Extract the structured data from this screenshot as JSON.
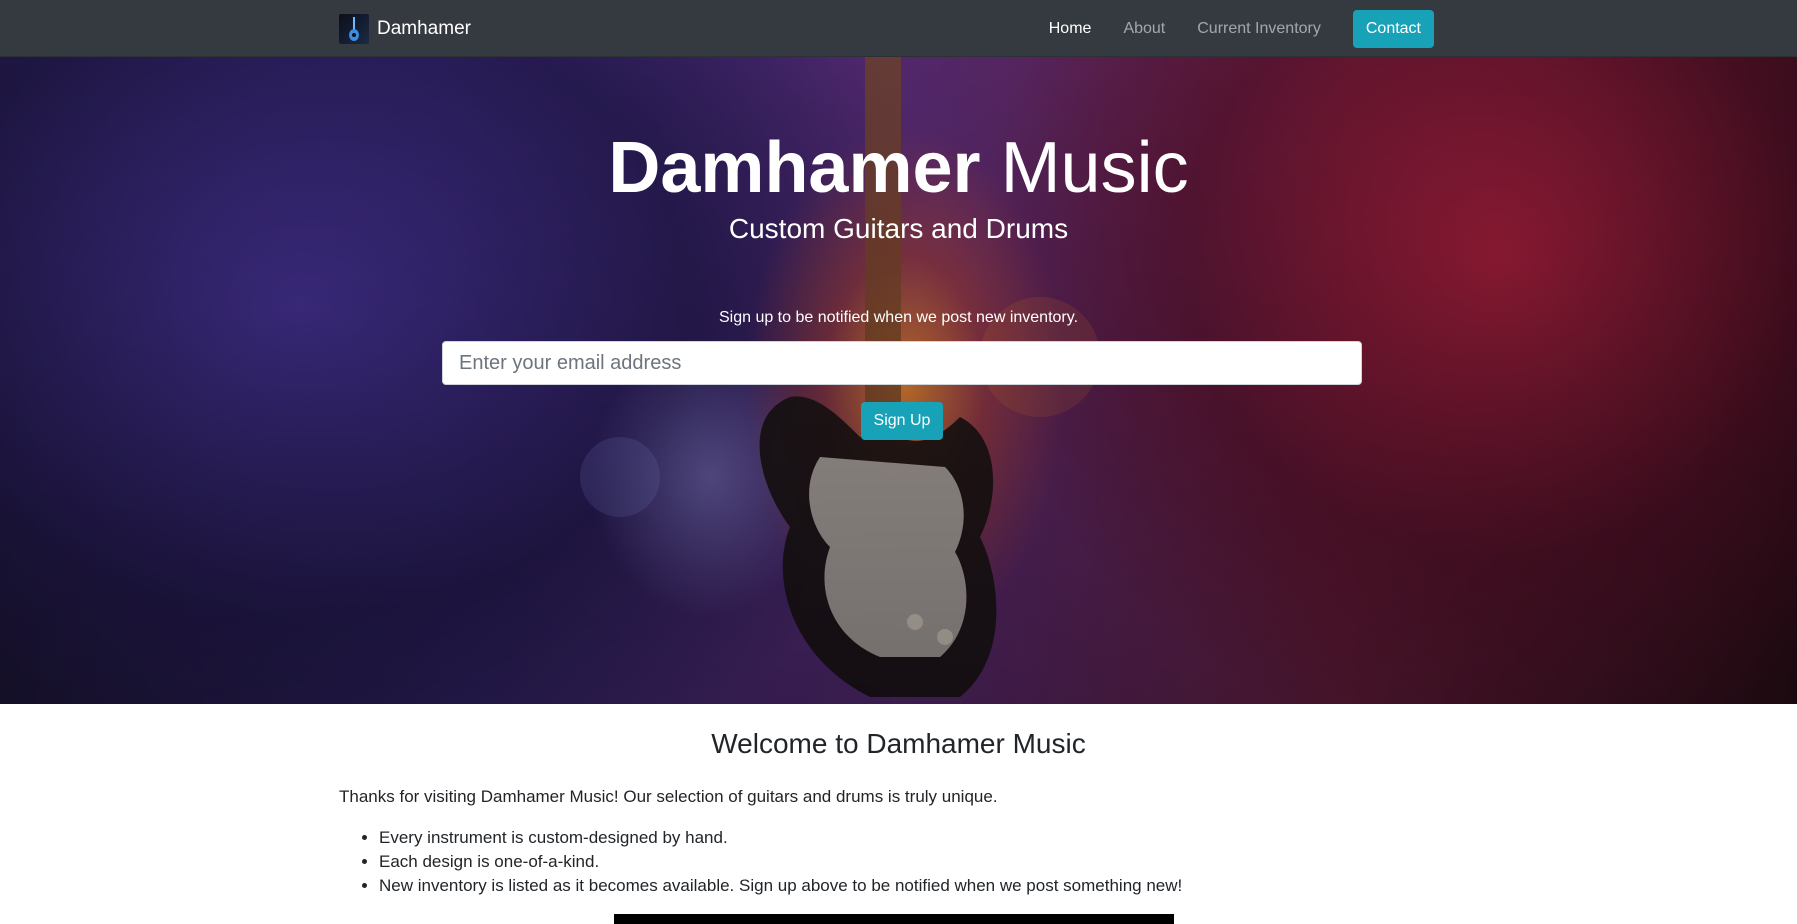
{
  "navbar": {
    "brand": "Damhamer",
    "brand_icon": "guitar-logo-icon",
    "links": [
      {
        "label": "Home",
        "active": true
      },
      {
        "label": "About",
        "active": false
      },
      {
        "label": "Current Inventory",
        "active": false
      }
    ],
    "contact_label": "Contact"
  },
  "hero": {
    "title_strong": "Damhamer",
    "title_light": "Music",
    "subtitle": "Custom Guitars and Drums",
    "signup_text": "Sign up to be notified when we post new inventory.",
    "email_placeholder": "Enter your email address",
    "email_value": "",
    "signup_button": "Sign Up"
  },
  "main": {
    "heading": "Welcome to Damhamer Music",
    "intro": "Thanks for visiting Damhamer Music! Our selection of guitars and drums is truly unique.",
    "features": [
      "Every instrument is custom-designed by hand.",
      "Each design is one-of-a-kind.",
      "New inventory is listed as it becomes available. Sign up above to be notified when we post something new!"
    ]
  },
  "colors": {
    "navbar_bg": "#343a40",
    "accent": "#17a2b8",
    "text": "#212529"
  }
}
